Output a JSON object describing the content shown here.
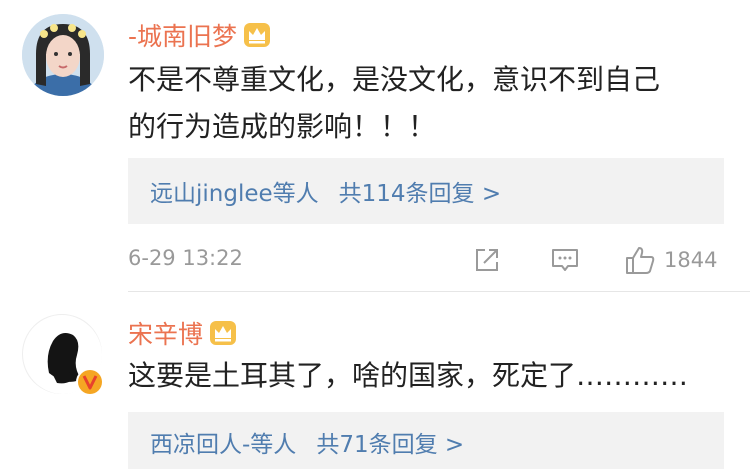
{
  "comments": [
    {
      "username": "-城南旧梦",
      "text_lines": [
        "不是不尊重文化，是没文化，意识不到自己",
        "的行为造成的影响！！！"
      ],
      "replies": {
        "names": "远山jinglee等人",
        "total": "共114条回复 >"
      },
      "time": "6-29 13:22",
      "likes": "1844"
    },
    {
      "username": "宋辛博",
      "text_lines": [
        "这要是土耳其了，啥的国家，死定了…………"
      ],
      "replies": {
        "names": "西凉回人-等人",
        "total": "共71条回复 >"
      },
      "verified_badge": "V"
    }
  ],
  "colors": {
    "username": "#eb7350",
    "reply_link": "#507daf",
    "meta_gray": "#999999",
    "reply_bg": "#f2f2f2"
  },
  "icons": [
    "crown-icon",
    "share-icon",
    "comment-icon",
    "like-icon",
    "verified-icon"
  ]
}
